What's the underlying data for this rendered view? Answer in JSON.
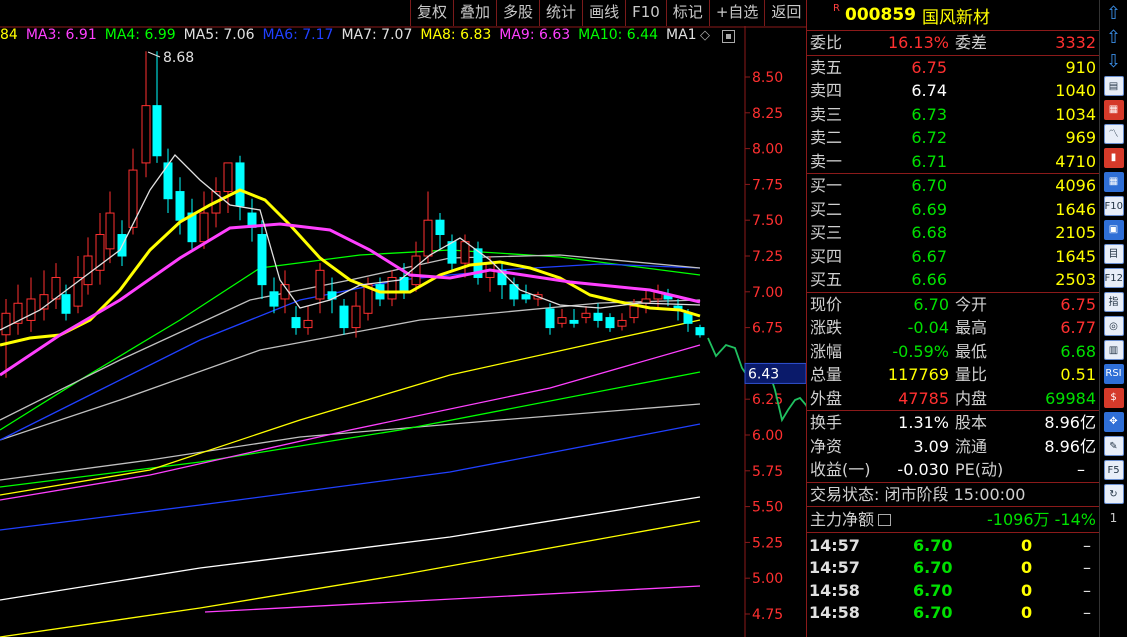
{
  "toolbar": {
    "items": [
      "复权",
      "叠加",
      "多股",
      "统计",
      "画线",
      "F10",
      "标记",
      "+自选",
      "返回"
    ]
  },
  "ma_legend": [
    {
      "label": "84",
      "color": "#ffff00"
    },
    {
      "label": "MA3: 6.91",
      "color": "#ff40ff"
    },
    {
      "label": "MA4: 6.99",
      "color": "#00ff00"
    },
    {
      "label": "MA5: 7.06",
      "color": "#e0e0e0"
    },
    {
      "label": "MA6: 7.17",
      "color": "#2040ff"
    },
    {
      "label": "MA7: 7.07",
      "color": "#e0e0e0"
    },
    {
      "label": "MA8: 6.83",
      "color": "#ffff00"
    },
    {
      "label": "MA9: 6.63",
      "color": "#ff40ff"
    },
    {
      "label": "MA10: 6.44",
      "color": "#00ff00"
    },
    {
      "label": "MA1",
      "color": "#e0e0e0"
    }
  ],
  "price_axis": {
    "ticks": [
      "8.50",
      "8.25",
      "8.00",
      "7.75",
      "7.50",
      "7.25",
      "7.00",
      "6.75",
      "6.25",
      "6.00",
      "5.75",
      "5.50",
      "5.25",
      "5.00",
      "4.75"
    ],
    "current_label": "6.43",
    "high_label": "8.68"
  },
  "stock": {
    "r_mark": "R",
    "code": "000859",
    "name": "国风新材"
  },
  "commission": {
    "ratio_label": "委比",
    "ratio_value": "16.13%",
    "diff_label": "委差",
    "diff_value": "3332"
  },
  "sell_orders": [
    {
      "label": "卖五",
      "price": "6.75",
      "volume": "910"
    },
    {
      "label": "卖四",
      "price": "6.74",
      "volume": "1040"
    },
    {
      "label": "卖三",
      "price": "6.73",
      "volume": "1034"
    },
    {
      "label": "卖二",
      "price": "6.72",
      "volume": "969"
    },
    {
      "label": "卖一",
      "price": "6.71",
      "volume": "4710"
    }
  ],
  "buy_orders": [
    {
      "label": "买一",
      "price": "6.70",
      "volume": "4096"
    },
    {
      "label": "买二",
      "price": "6.69",
      "volume": "1646"
    },
    {
      "label": "买三",
      "price": "6.68",
      "volume": "2105"
    },
    {
      "label": "买四",
      "price": "6.67",
      "volume": "1645"
    },
    {
      "label": "买五",
      "price": "6.66",
      "volume": "2503"
    }
  ],
  "quote": {
    "price_label": "现价",
    "price": "6.70",
    "open_label": "今开",
    "open": "6.75",
    "change_label": "涨跌",
    "change": "-0.04",
    "high_label": "最高",
    "high": "6.77",
    "pct_label": "涨幅",
    "pct": "-0.59%",
    "low_label": "最低",
    "low": "6.68",
    "vol_label": "总量",
    "vol": "117769",
    "volratio_label": "量比",
    "volratio": "0.51",
    "outer_label": "外盘",
    "outer": "47785",
    "inner_label": "内盘",
    "inner": "69984"
  },
  "fund": {
    "turnover_label": "换手",
    "turnover": "1.31%",
    "equity_label": "股本",
    "equity": "8.96亿",
    "nav_label": "净资",
    "nav": "3.09",
    "float_label": "流通",
    "float": "8.96亿",
    "eps_label": "收益(一)",
    "eps": "-0.030",
    "pe_label": "PE(动)",
    "pe": "–"
  },
  "trade_status": "交易状态: 闭市阶段 15:00:00",
  "main_flow": {
    "label": "主力净额",
    "value": "-1096万",
    "pct": "-14%"
  },
  "ticks": [
    {
      "time": "14:57",
      "price": "6.70",
      "vol": "0",
      "dir": "–"
    },
    {
      "time": "14:57",
      "price": "6.70",
      "vol": "0",
      "dir": "–"
    },
    {
      "time": "14:58",
      "price": "6.70",
      "vol": "0",
      "dir": "–"
    },
    {
      "time": "14:58",
      "price": "6.70",
      "vol": "0",
      "dir": "–"
    }
  ],
  "sidebar": {
    "items": [
      {
        "name": "arrow-up-icon",
        "glyph": "⇧"
      },
      {
        "name": "arrow-up-2-icon",
        "glyph": "⇧"
      },
      {
        "name": "arrow-down-icon",
        "glyph": "⇩"
      },
      {
        "name": "report-icon",
        "glyph": "▤"
      },
      {
        "name": "grid-icon",
        "glyph": "▦"
      },
      {
        "name": "line-chart-icon",
        "glyph": "〽"
      },
      {
        "name": "kline-icon",
        "glyph": "▮"
      },
      {
        "name": "table-icon",
        "glyph": "▦"
      },
      {
        "name": "f10-icon",
        "glyph": "F10"
      },
      {
        "name": "info-icon",
        "glyph": "▣"
      },
      {
        "name": "doc-icon",
        "glyph": "目"
      },
      {
        "name": "f12-icon",
        "glyph": "F12"
      },
      {
        "name": "index-icon",
        "glyph": "指"
      },
      {
        "name": "circle-icon",
        "glyph": "◎"
      },
      {
        "name": "stats-icon",
        "glyph": "▥"
      },
      {
        "name": "rsi-icon",
        "glyph": "RSI"
      },
      {
        "name": "money-icon",
        "glyph": "$"
      },
      {
        "name": "move-icon",
        "glyph": "✥"
      },
      {
        "name": "pencil-icon",
        "glyph": "✎"
      },
      {
        "name": "f5-icon",
        "glyph": "F5"
      },
      {
        "name": "refresh-icon",
        "glyph": "↻"
      },
      {
        "name": "page-number",
        "glyph": "1"
      }
    ]
  }
}
